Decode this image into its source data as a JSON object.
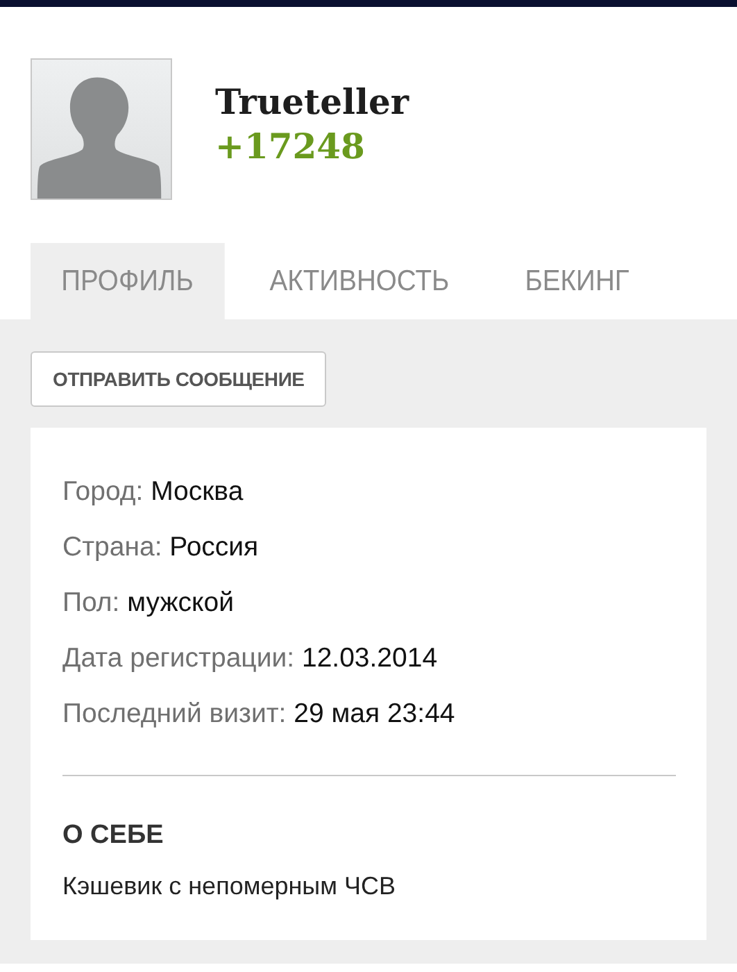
{
  "user": {
    "name": "Trueteller",
    "score": "+17248"
  },
  "tabs": [
    {
      "label": "ПРОФИЛЬ",
      "selected": true
    },
    {
      "label": "АКТИВНОСТЬ",
      "selected": false
    },
    {
      "label": "БЕКИНГ",
      "selected": false
    }
  ],
  "message_button": "ОТПРАВИТЬ СООБЩЕНИЕ",
  "fields": [
    {
      "label": "Город:",
      "value": "Москва"
    },
    {
      "label": "Страна:",
      "value": "Россия"
    },
    {
      "label": "Пол:",
      "value": "мужской"
    },
    {
      "label": "Дата регистрации:",
      "value": "12.03.2014"
    },
    {
      "label": "Последний визит:",
      "value": "29 мая 23:44"
    }
  ],
  "about": {
    "title": "О СЕБЕ",
    "text": "Кэшевик с непомерным ЧСВ"
  }
}
